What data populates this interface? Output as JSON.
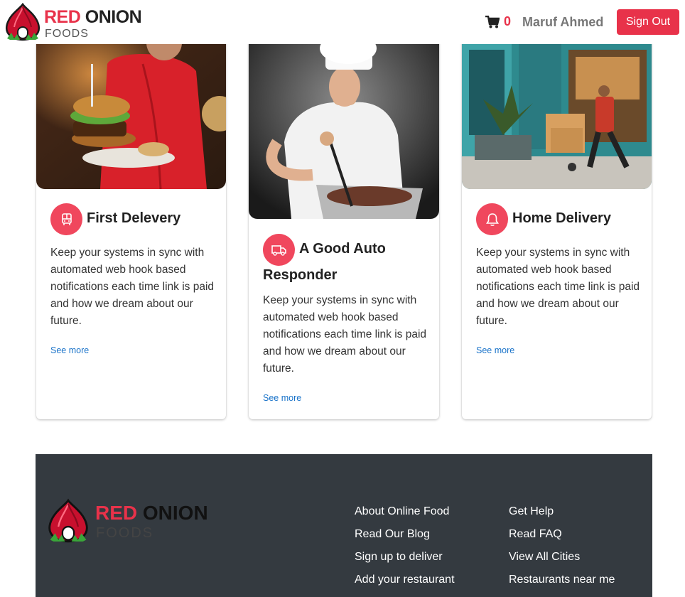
{
  "brand": {
    "name_red": "RED",
    "name_dark": "ONION",
    "sub": "FOODS"
  },
  "header": {
    "cart_count": "0",
    "user_name": "Maruf Ahmed",
    "signout_label": "Sign Out"
  },
  "cards": [
    {
      "title": "First Delevery",
      "text": "Keep your systems in sync with automated web hook based notifications each time link is paid and how we dream about our future.",
      "link": "See more",
      "icon": "bus-icon"
    },
    {
      "title": "A Good Auto Responder",
      "text": "Keep your systems in sync with automated web hook based notifications each time link is paid and how we dream about our future.",
      "link": "See more",
      "icon": "truck-icon"
    },
    {
      "title": "Home Delivery",
      "text": "Keep your systems in sync with automated web hook based notifications each time link is paid and how we dream about our future.",
      "link": "See more",
      "icon": "bell-icon"
    }
  ],
  "footer": {
    "col1": [
      "About Online Food",
      "Read Our Blog",
      "Sign up to deliver",
      "Add your restaurant"
    ],
    "col2": [
      "Get Help",
      "Read FAQ",
      "View All Cities",
      "Restaurants near me"
    ]
  },
  "colors": {
    "accent": "#e8324a",
    "footer_bg": "#343a40",
    "link": "#1a73c9"
  }
}
